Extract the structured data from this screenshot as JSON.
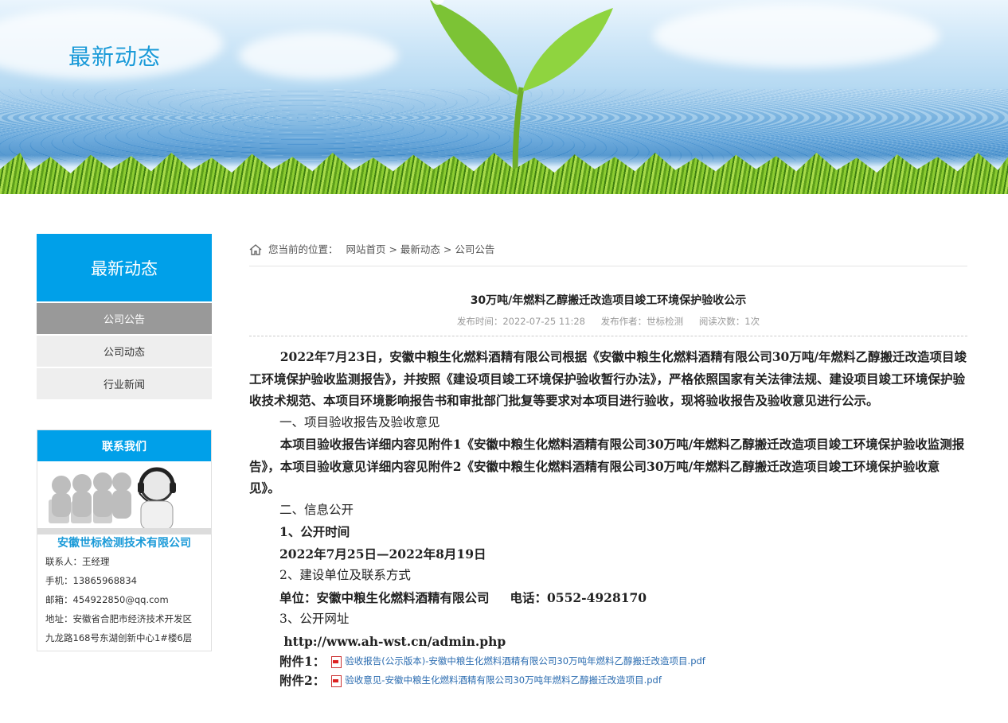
{
  "banner": {
    "title": "最新动态"
  },
  "sidebar": {
    "heading": "最新动态",
    "items": [
      {
        "label": "公司公告",
        "active": true
      },
      {
        "label": "公司动态",
        "active": false
      },
      {
        "label": "行业新闻",
        "active": false
      }
    ]
  },
  "contact": {
    "heading": "联系我们",
    "company": "安徽世标检测技术有限公司",
    "lines": [
      "联系人：王经理",
      "手机：13865968834",
      "邮箱：454922850@qq.com",
      "地址：安徽省合肥市经济技术开发区",
      "九龙路168号东湖创新中心1#楼6层"
    ]
  },
  "breadcrumb": {
    "prefix": "您当前的位置：",
    "path": "网站首页 > 最新动态 > 公司公告"
  },
  "article": {
    "title": "30万吨/年燃料乙醇搬迁改造项目竣工环境保护验收公示",
    "publish_time": "发布时间：2022-07-25 11:28",
    "author": "发布作者：世标检测",
    "views": "阅读次数：1次",
    "para1": "2022年7月23日，安徽中粮生化燃料酒精有限公司根据《安徽中粮生化燃料酒精有限公司30万吨/年燃料乙醇搬迁改造项目竣工环境保护验收监测报告》，并按照《建设项目竣工环境保护验收暂行办法》，严格依照国家有关法律法规、建设项目竣工环境保护验收技术规范、本项目环境影响报告书和审批部门批复等要求对本项目进行验收，现将验收报告及验收意见进行公示。",
    "sec1": "一、项目验收报告及验收意见",
    "para2": "本项目验收报告详细内容见附件1《安徽中粮生化燃料酒精有限公司30万吨/年燃料乙醇搬迁改造项目竣工环境保护验收监测报告》，本项目验收意见详细内容见附件2《安徽中粮生化燃料酒精有限公司30万吨/年燃料乙醇搬迁改造项目竣工环境保护验收意见》。",
    "sec2": "二、信息公开",
    "sub1": "1、公开时间",
    "date_range": "2022年7月25日—2022年8月19日",
    "sub2": "2、建设单位及联系方式",
    "unit": "单位：安徽中粮生化燃料酒精有限公司",
    "phone": "电话：0552-4928170",
    "sub3": "3、公开网址",
    "url": " http://www.ah-wst.cn/admin.php",
    "attach1_label": "附件1：",
    "attach1_link": "验收报告(公示版本)-安徽中粮生化燃料酒精有限公司30万吨年燃料乙醇搬迁改造项目.pdf",
    "attach2_label": "附件2：",
    "attach2_link": "验收意见-安徽中粮生化燃料酒精有限公司30万吨年燃料乙醇搬迁改造项目.pdf"
  }
}
